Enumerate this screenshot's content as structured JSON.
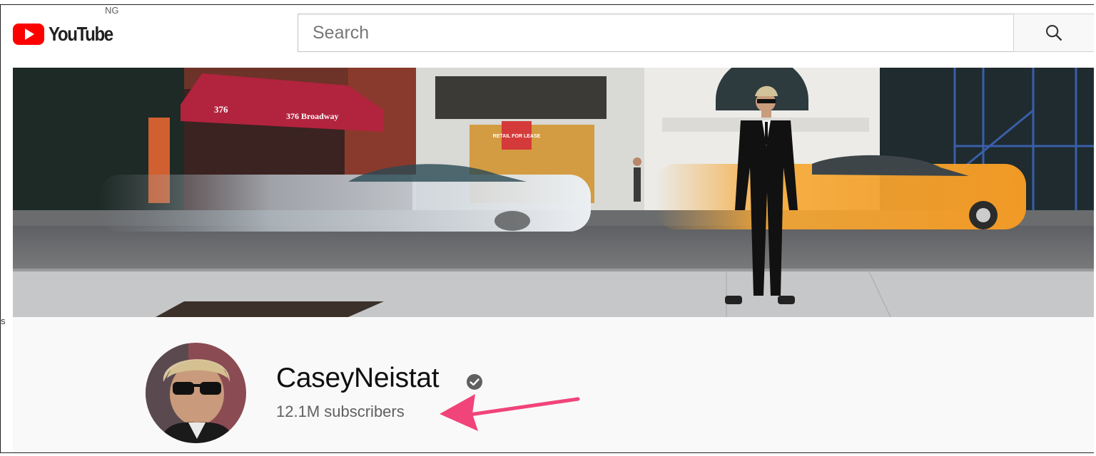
{
  "masthead": {
    "logo_text": "YouTube",
    "country_code": "NG",
    "logo_icon": "youtube-play-icon",
    "search": {
      "placeholder": "Search",
      "value": "",
      "icon": "search-icon"
    }
  },
  "banner": {
    "signs": {
      "awning_number": "376",
      "awning_street": "376 Broadway",
      "lease_sign": "RETAIL FOR LEASE"
    }
  },
  "channel": {
    "name": "CaseyNeistat",
    "verified_icon": "verified-check-icon",
    "subscribers": "12.1M subscribers"
  },
  "annotation": {
    "arrow_color": "#f0447a"
  },
  "edge_text": "s",
  "colors": {
    "brand_red": "#ff0000",
    "header_bg": "#f9f9f9",
    "subtext": "#606060"
  }
}
